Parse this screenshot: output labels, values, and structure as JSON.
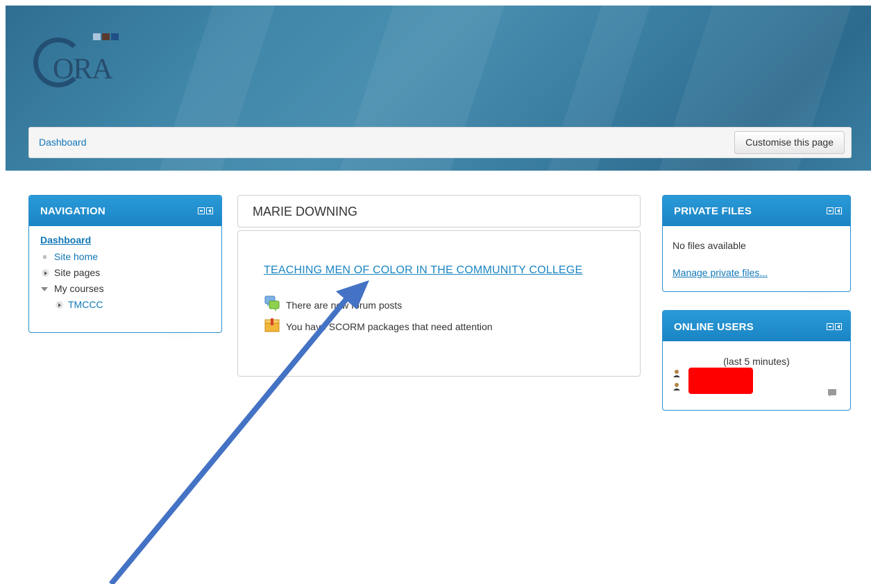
{
  "header": {
    "logo_text": "ORA",
    "breadcrumb": "Dashboard",
    "customise_label": "Customise this page"
  },
  "navigation": {
    "title": "NAVIGATION",
    "root": "Dashboard",
    "items": [
      {
        "label": "Site home"
      },
      {
        "label": "Site pages"
      },
      {
        "label": "My courses"
      },
      {
        "label": "TMCCC"
      }
    ]
  },
  "main": {
    "user_name": "MARIE DOWNING",
    "course": "TEACHING MEN OF COLOR IN THE COMMUNITY COLLEGE",
    "notices": [
      {
        "text": "There are new forum posts",
        "icon": "forum-icon"
      },
      {
        "text": "You have SCORM packages that need attention",
        "icon": "scorm-package-icon"
      }
    ]
  },
  "private_files": {
    "title": "PRIVATE FILES",
    "empty_text": "No files available",
    "manage_link": "Manage private files..."
  },
  "online_users": {
    "title": "ONLINE USERS",
    "caption": "(last 5 minutes)"
  },
  "colors": {
    "accent": "#1a84c4",
    "link": "#1177b8",
    "annotation_arrow": "#4472c4",
    "redaction": "#ff0000"
  }
}
